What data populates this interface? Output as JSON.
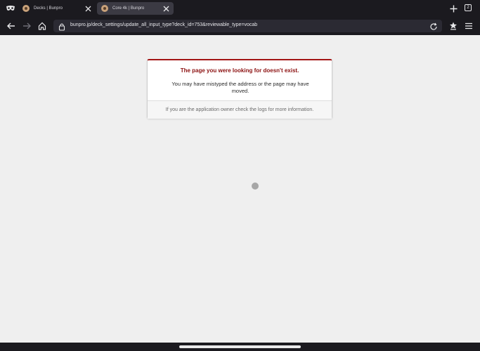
{
  "tabs": [
    {
      "title": "Decks | Bunpro",
      "active": false
    },
    {
      "title": "Core 4k | Bunpro",
      "active": true
    }
  ],
  "tab_count": "2",
  "address_bar": {
    "url": "bunpro.jp/deck_settings/update_all_input_type?deck_id=753&reviewable_type=vocab"
  },
  "error": {
    "heading": "The page you were looking for doesn't exist.",
    "body": "You may have mistyped the address or the page may have moved.",
    "footer": "If you are the application owner check the logs for more information."
  },
  "colors": {
    "chrome_bg": "#1b1a1f",
    "page_bg": "#efefef",
    "error_accent": "#a31515"
  },
  "icons": [
    "private-mask-icon",
    "close-icon",
    "plus-icon",
    "back-icon",
    "forward-icon",
    "home-icon",
    "lock-icon",
    "reload-icon",
    "reader-icon",
    "menu-icon"
  ]
}
